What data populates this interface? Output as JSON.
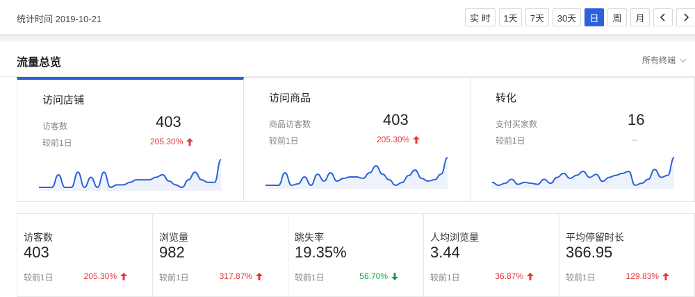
{
  "header": {
    "stat_time": "统计时间 2019-10-21",
    "buttons": [
      {
        "label": "实 时",
        "active": false
      },
      {
        "label": "1天",
        "active": false
      },
      {
        "label": "7天",
        "active": false
      },
      {
        "label": "30天",
        "active": false
      },
      {
        "label": "日",
        "active": true
      },
      {
        "label": "周",
        "active": false
      },
      {
        "label": "月",
        "active": false
      }
    ],
    "prev_icon": "chevron-left-icon",
    "next_icon": "chevron-right-icon"
  },
  "panel": {
    "title": "流量总览",
    "terminal": "所有终端"
  },
  "cards": [
    {
      "title": "访问店铺",
      "metric_label": "访客数",
      "value": "403",
      "compare_label": "较前1日",
      "change": "205.30%",
      "direction": "up",
      "series": [
        0,
        0,
        0,
        10,
        0,
        0,
        12,
        0,
        8,
        0,
        12,
        0,
        2,
        2,
        4,
        6,
        6,
        6,
        8,
        10,
        5,
        2,
        0,
        6,
        12,
        6,
        4,
        4,
        22
      ]
    },
    {
      "title": "访问商品",
      "metric_label": "商品访客数",
      "value": "403",
      "compare_label": "较前1日",
      "change": "205.30%",
      "direction": "up",
      "series": [
        0,
        0,
        0,
        9,
        0,
        1,
        6,
        0,
        8,
        3,
        9,
        3,
        5,
        6,
        6,
        5,
        9,
        14,
        8,
        4,
        0,
        2,
        7,
        11,
        5,
        3,
        4,
        8,
        20
      ]
    },
    {
      "title": "转化",
      "metric_label": "支付买家数",
      "value": "16",
      "compare_label": "较前1日",
      "change": "–",
      "direction": "none",
      "series": [
        5,
        2,
        4,
        8,
        3,
        5,
        4,
        3,
        8,
        4,
        10,
        14,
        9,
        12,
        16,
        10,
        13,
        6,
        10,
        12,
        14,
        16,
        2,
        4,
        8,
        18,
        10,
        12,
        30
      ]
    }
  ],
  "metrics": [
    {
      "label": "访客数",
      "value": "403",
      "compare_label": "较前1日",
      "change": "205.30%",
      "direction": "up"
    },
    {
      "label": "浏览量",
      "value": "982",
      "compare_label": "较前1日",
      "change": "317.87%",
      "direction": "up"
    },
    {
      "label": "跳失率",
      "value": "19.35%",
      "compare_label": "较前1日",
      "change": "56.70%",
      "direction": "down"
    },
    {
      "label": "人均浏览量",
      "value": "3.44",
      "compare_label": "较前1日",
      "change": "36.87%",
      "direction": "up"
    },
    {
      "label": "平均停留时长",
      "value": "366.95",
      "compare_label": "较前1日",
      "change": "129.83%",
      "direction": "up"
    }
  ],
  "colors": {
    "accent": "#2b62d9",
    "up": "#e8363b",
    "down": "#1aa148",
    "spark_fill": "#eef2fb"
  }
}
